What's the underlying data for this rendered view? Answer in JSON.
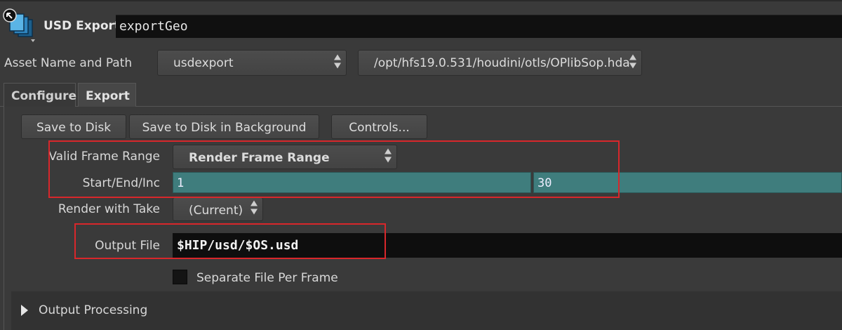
{
  "header": {
    "node_type": "USD Export",
    "node_name": "exportGeo",
    "icon": "usd-export-icon"
  },
  "asset": {
    "label": "Asset Name and Path",
    "name": "usdexport",
    "path": "/opt/hfs19.0.531/houdini/otls/OPlibSop.hda"
  },
  "tabs": [
    {
      "label": "Configure"
    },
    {
      "label": "Export",
      "selected": true
    }
  ],
  "buttons": {
    "save": "Save to Disk",
    "save_bg": "Save to Disk in Background",
    "controls": "Controls..."
  },
  "parms": {
    "frame_range_label": "Valid Frame Range",
    "frame_range_value": "Render Frame Range",
    "start_end_label": "Start/End/Inc",
    "start": "1",
    "end": "30",
    "take_label": "Render with Take",
    "take_value": "(Current)",
    "output_label": "Output File",
    "output_value": "$HIP/usd/$OS.usd",
    "separate_label": "Separate File Per Frame",
    "separate_checked": false
  },
  "folder": {
    "label": "Output Processing",
    "expanded": false
  },
  "colors": {
    "accent_field": "#3f7d7d",
    "annotation": "#d8272b"
  }
}
